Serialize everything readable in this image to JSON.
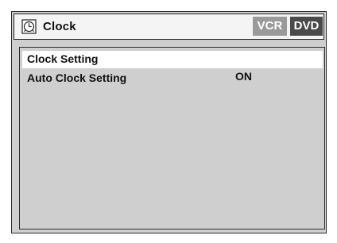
{
  "header": {
    "title": "Clock",
    "icon": "clock-icon",
    "badges": [
      {
        "label": "VCR",
        "color": "#9a9a9a"
      },
      {
        "label": "DVD",
        "color": "#4a4a4a"
      }
    ]
  },
  "menu": {
    "items": [
      {
        "label": "Clock Setting",
        "value": "",
        "selected": true
      },
      {
        "label": "Auto Clock Setting",
        "value": "ON",
        "selected": false
      }
    ]
  },
  "colors": {
    "panel_background": "#cfcfcf",
    "header_background": "#f4f4f4",
    "selected_row": "#ffffff",
    "border": "#2a2a2a"
  }
}
